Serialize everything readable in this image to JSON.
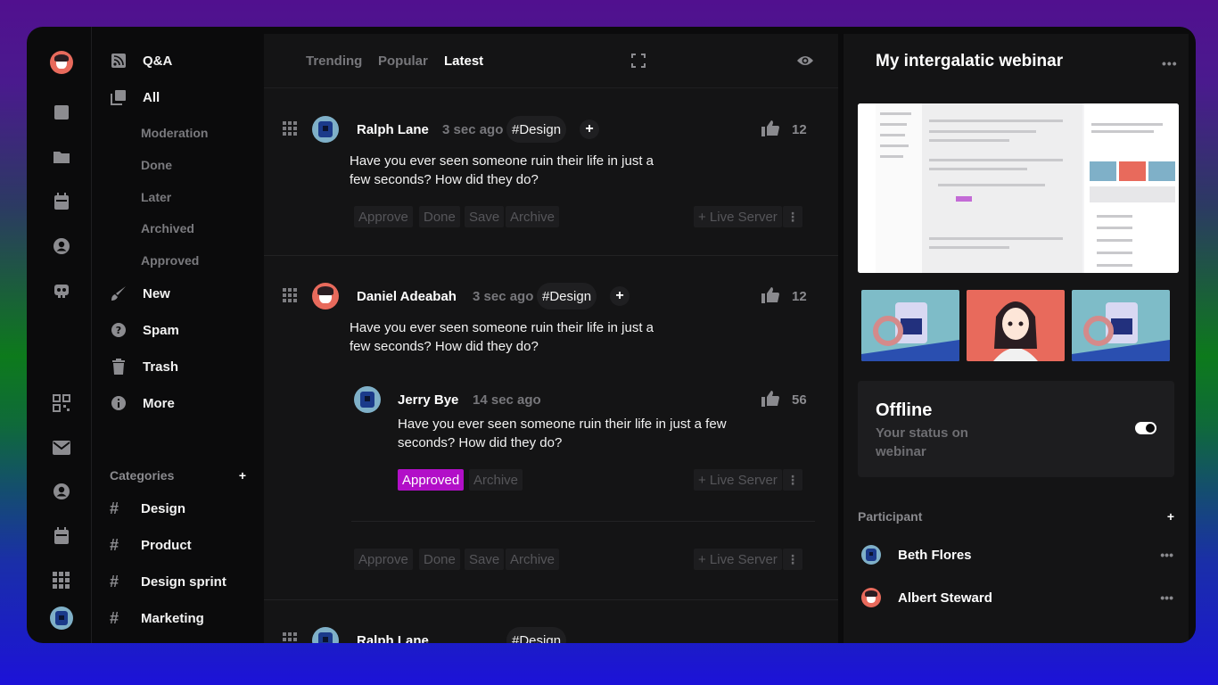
{
  "rail": {
    "icons": [
      "user-avatar",
      "square-icon",
      "folder-icon",
      "calendar-icon",
      "account-circle-icon",
      "bot-icon",
      "qr-code-icon",
      "mail-icon",
      "account-circle-icon",
      "calendar-icon",
      "apps-grid-icon",
      "profile-avatar"
    ]
  },
  "nav": {
    "qa": "Q&A",
    "all": "All",
    "subs": [
      "Moderation",
      "Done",
      "Later",
      "Archived",
      "Approved"
    ],
    "new": "New",
    "spam": "Spam",
    "trash": "Trash",
    "more": "More",
    "categories_label": "Categories",
    "categories_add": "+",
    "categories": [
      "Design",
      "Product",
      "Design sprint",
      "Marketing"
    ],
    "hash": "#"
  },
  "feed": {
    "tabs": [
      "Trending",
      "Popular",
      "Latest"
    ],
    "active_tab": "Latest",
    "posts": [
      {
        "user": "Ralph Lane",
        "time": "3 sec ago",
        "tag": "#Design",
        "likes": "12",
        "text": "Have you ever seen someone ruin their life in just a few seconds? How did they do?",
        "actions": [
          "Approve",
          "Done",
          "Save",
          "Archive"
        ],
        "live": "+ Live Server"
      },
      {
        "user": "Daniel Adeabah",
        "time": "3 sec ago",
        "tag": "#Design",
        "likes": "12",
        "text": "Have you ever seen someone ruin their life in just a few seconds? How did they do?",
        "reply": {
          "user": "Jerry Bye",
          "time": "14 sec ago",
          "likes": "56",
          "text": "Have you ever seen someone ruin their life in just a few seconds? How did they do?",
          "actions": [
            "Approved",
            "Archive"
          ],
          "live": "+ Live Server"
        },
        "actions": [
          "Approve",
          "Done",
          "Save",
          "Archive"
        ],
        "live": "+ Live Server"
      }
    ]
  },
  "webinar": {
    "title": "My intergalatic webinar",
    "menu": "•••",
    "status_title": "Offline",
    "status_sub": "Your status on webinar",
    "status_on": true,
    "participants_label": "Participant",
    "participants_add": "+",
    "participants": [
      "Beth Flores",
      "Albert Steward"
    ],
    "row_menu": "•••"
  },
  "colors": {
    "accent": "#b20fc8",
    "panel": "#141415",
    "background": "#0b0b0c"
  }
}
